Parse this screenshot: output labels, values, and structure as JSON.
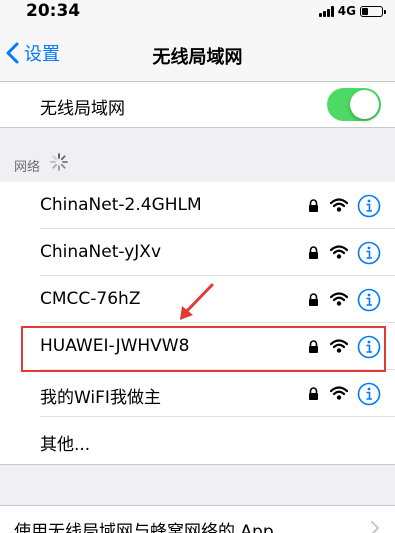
{
  "status_bar": {
    "time": "20:34",
    "network": "4G",
    "battery_level": 0.3
  },
  "nav": {
    "back_label": "设置",
    "title": "无线局域网"
  },
  "wlan": {
    "label": "无线局域网",
    "enabled": true
  },
  "section": {
    "label": "网络"
  },
  "networks": [
    {
      "name": "ChinaNet-2.4GHLM",
      "locked": true
    },
    {
      "name": "ChinaNet-yJXv",
      "locked": true
    },
    {
      "name": "CMCC-76hZ",
      "locked": true
    },
    {
      "name": "HUAWEI-JWHVW8",
      "locked": true,
      "highlighted": true
    },
    {
      "name": "我的WiFI我做主",
      "locked": true
    },
    {
      "name": "其他..."
    }
  ],
  "footer": {
    "label": "使用无线局域网与蜂窝网络的 App"
  },
  "colors": {
    "accent": "#007aff",
    "toggle_on": "#4cd964",
    "highlight": "#e53935"
  }
}
